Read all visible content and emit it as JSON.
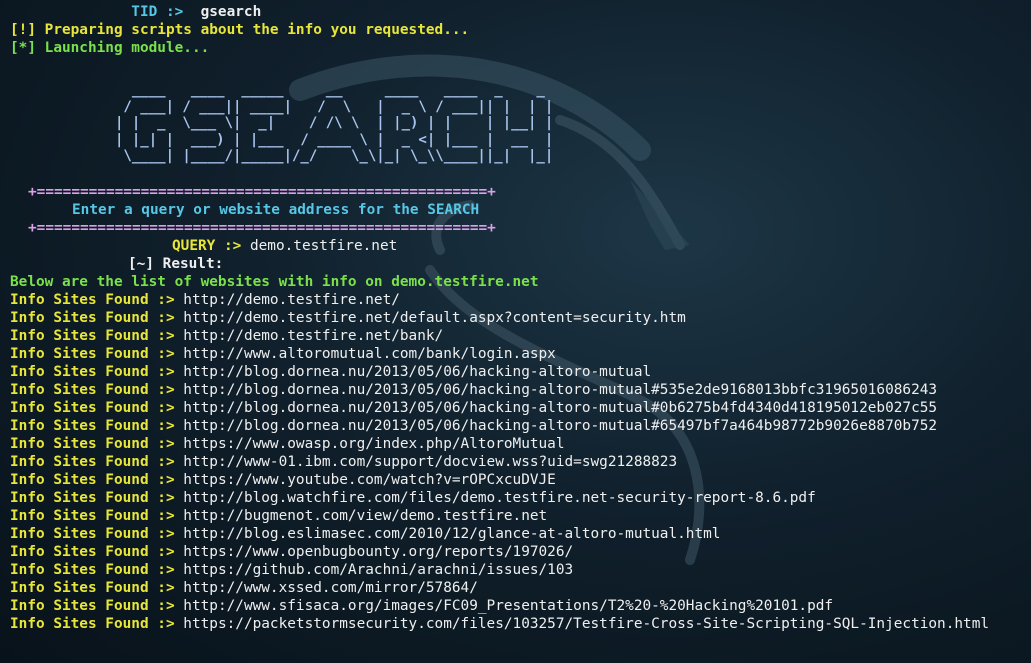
{
  "prompt": {
    "label": "TID :>",
    "command": "gsearch"
  },
  "status_lines": [
    "[!] Preparing scripts about the info you requested...",
    "[*] Launching module..."
  ],
  "banner": [
    "  ____   ____  _____     __     ____   ____  _    _",
    " / ___| / ___|| ____|   /  \\   |  _ \\ / ___|| |  | |",
    "| |  _  \\___ \\|  _|    / /\\ \\  | |_) | |    | |__| |",
    "| |_| |  ___) | |___  / ____ \\ |  _ <| |___ |  __  |",
    " \\____| |____/|_____|/_/    \\_\\|_| \\_\\\\____||_|  |_|"
  ],
  "separator": "+====================================================+",
  "instruction": "Enter a query or website address for the SEARCH",
  "query": {
    "label": "QUERY :>",
    "value": "demo.testfire.net"
  },
  "result_label": "[~] Result:",
  "summary": "Below are the list of websites with info on demo.testfire.net",
  "found_label": "Info Sites Found :>",
  "results": [
    "http://demo.testfire.net/",
    "http://demo.testfire.net/default.aspx?content=security.htm",
    "http://demo.testfire.net/bank/",
    "http://www.altoromutual.com/bank/login.aspx",
    "http://blog.dornea.nu/2013/05/06/hacking-altoro-mutual",
    "http://blog.dornea.nu/2013/05/06/hacking-altoro-mutual#535e2de9168013bbfc31965016086243",
    "http://blog.dornea.nu/2013/05/06/hacking-altoro-mutual#0b6275b4fd4340d418195012eb027c55",
    "http://blog.dornea.nu/2013/05/06/hacking-altoro-mutual#65497bf7a464b98772b9026e8870b752",
    "https://www.owasp.org/index.php/AltoroMutual",
    "http://www-01.ibm.com/support/docview.wss?uid=swg21288823",
    "https://www.youtube.com/watch?v=rOPCxcuDVJE",
    "http://blog.watchfire.com/files/demo.testfire.net-security-report-8.6.pdf",
    "http://bugmenot.com/view/demo.testfire.net",
    "http://blog.eslimasec.com/2010/12/glance-at-altoro-mutual.html",
    "https://www.openbugbounty.org/reports/197026/",
    "https://github.com/Arachni/arachni/issues/103",
    "http://www.xssed.com/mirror/57864/",
    "http://www.sfisaca.org/images/FC09_Presentations/T2%20-%20Hacking%20101.pdf",
    "https://packetstormsecurity.com/files/103257/Testfire-Cross-Site-Scripting-SQL-Injection.html"
  ],
  "colors": {
    "background": "#10202c",
    "yellow": "#e8e63a",
    "green": "#7be14a",
    "cyan": "#56c7e6",
    "separator": "#d9a2e6",
    "banner": "#a8c4ee"
  }
}
